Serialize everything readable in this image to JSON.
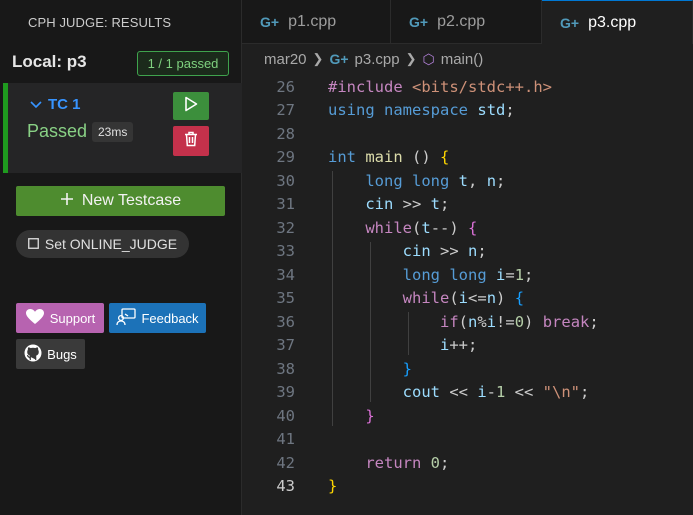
{
  "sidebar": {
    "panel_title": "CPH JUDGE: RESULTS",
    "local_title": "Local: p3",
    "passed_badge": "1 / 1 passed",
    "testcase": {
      "name": "TC 1",
      "status": "Passed",
      "time": "23ms"
    },
    "new_testcase_label": "New Testcase",
    "online_judge_label": "Set ONLINE_JUDGE",
    "support_label": "Support",
    "feedback_label": "Feedback",
    "bugs_label": "Bugs"
  },
  "tabs": [
    {
      "label": "p1.cpp",
      "active": false
    },
    {
      "label": "p2.cpp",
      "active": false
    },
    {
      "label": "p3.cpp",
      "active": true
    }
  ],
  "breadcrumb": {
    "folder": "mar20",
    "file": "p3.cpp",
    "symbol": "main()"
  },
  "editor": {
    "current_line": 43,
    "lines": [
      {
        "n": "26",
        "text": "#include <bits/stdc++.h>"
      },
      {
        "n": "27",
        "text": "using namespace std;"
      },
      {
        "n": "28",
        "text": ""
      },
      {
        "n": "29",
        "text": "int main () {"
      },
      {
        "n": "30",
        "text": "    long long t, n;"
      },
      {
        "n": "31",
        "text": "    cin >> t;"
      },
      {
        "n": "32",
        "text": "    while(t--) {"
      },
      {
        "n": "33",
        "text": "        cin >> n;"
      },
      {
        "n": "34",
        "text": "        long long i=1;"
      },
      {
        "n": "35",
        "text": "        while(i<=n) {"
      },
      {
        "n": "36",
        "text": "            if(n%i!=0) break;"
      },
      {
        "n": "37",
        "text": "            i++;"
      },
      {
        "n": "38",
        "text": "        }"
      },
      {
        "n": "39",
        "text": "        cout << i-1 << \"\\n\";"
      },
      {
        "n": "40",
        "text": "    }"
      },
      {
        "n": "41",
        "text": ""
      },
      {
        "n": "42",
        "text": "    return 0;"
      },
      {
        "n": "43",
        "text": "}"
      }
    ]
  },
  "colors": {
    "accent": "#0078d4",
    "pass_green": "#89d185",
    "delete_red": "#c4314b",
    "support_pink": "#b763b0",
    "feedback_blue": "#1c72b8"
  }
}
